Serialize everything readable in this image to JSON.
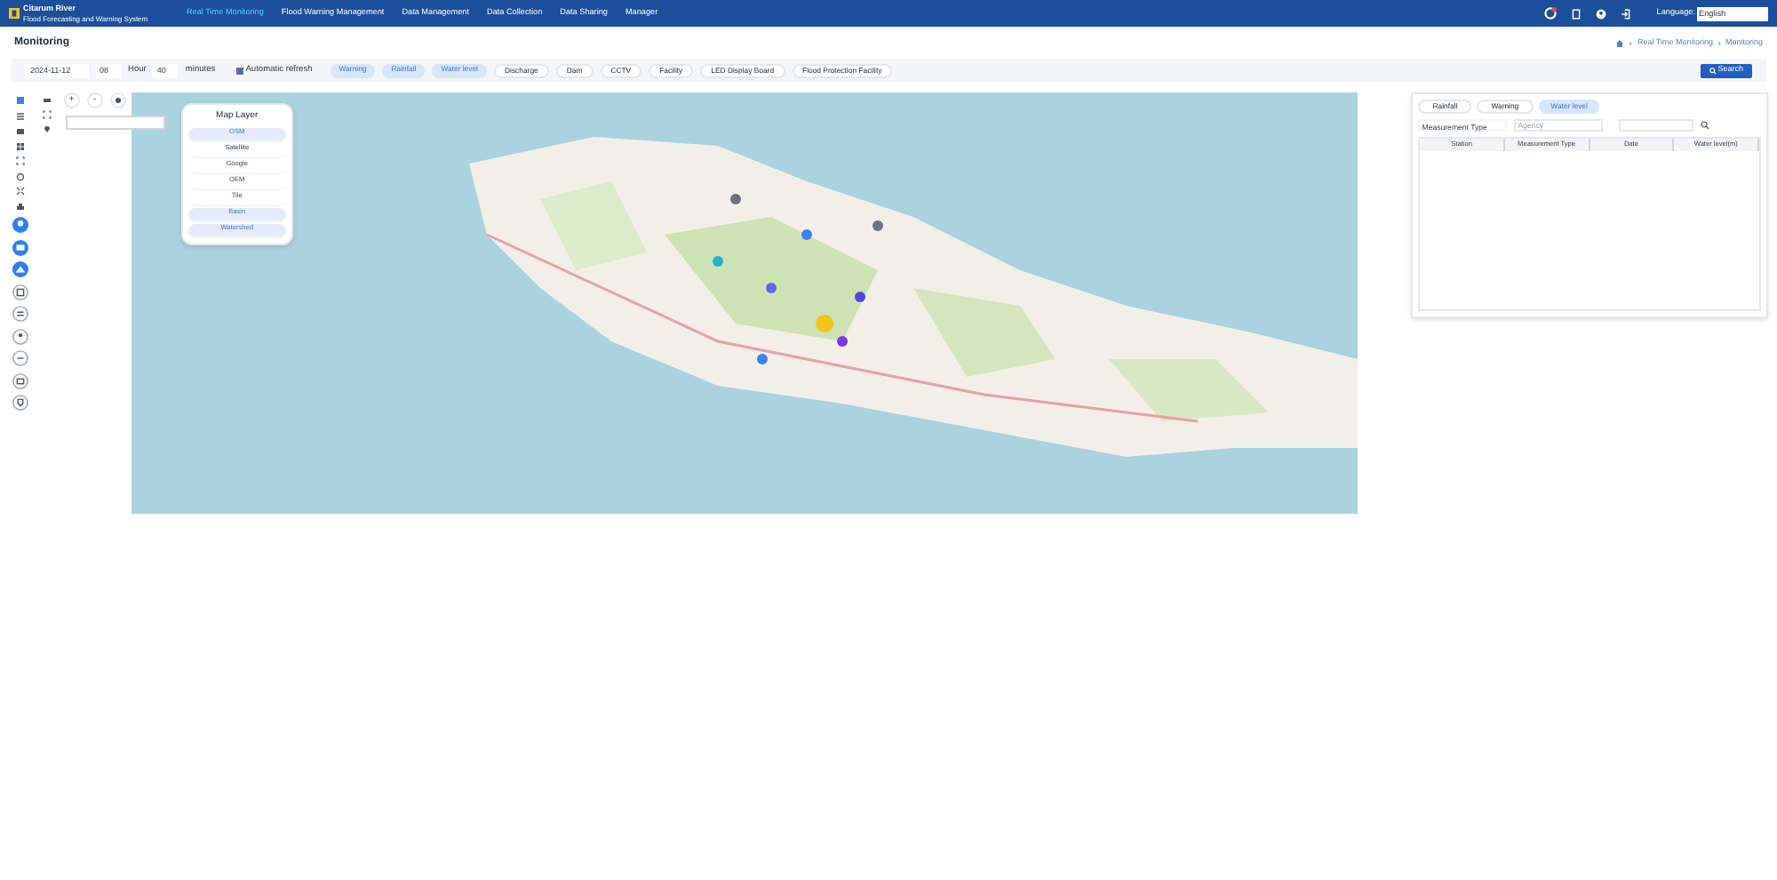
{
  "header": {
    "logo_title": "Citarum River",
    "logo_subtitle": "Flood Forecasting and Warning System",
    "nav": [
      {
        "label": "Real Time Monitoring",
        "selected": true
      },
      {
        "label": "Flood Warning Management",
        "selected": false
      },
      {
        "label": "Data Management",
        "selected": false
      },
      {
        "label": "Data Collection",
        "selected": false
      },
      {
        "label": "Data Sharing",
        "selected": false
      },
      {
        "label": "Manager",
        "selected": false
      }
    ],
    "language_label": "Language:",
    "language_value": "English"
  },
  "page_title": "Monitoring",
  "breadcrumb": [
    "Real Time Monitoring",
    "Monitoring"
  ],
  "filters": {
    "date": "2024-11-12",
    "hour": "08",
    "hour_label": "Hour",
    "minute": "40",
    "minute_label": "minutes",
    "auto_refresh": {
      "label": "Automatic refresh",
      "checked": true
    },
    "chips": [
      {
        "label": "Warning",
        "selected": true
      },
      {
        "label": "Rainfall",
        "selected": true
      },
      {
        "label": "Water level",
        "selected": true
      },
      {
        "label": "Discharge",
        "selected": false
      },
      {
        "label": "Dam",
        "selected": false
      },
      {
        "label": "CCTV",
        "selected": false
      },
      {
        "label": "Facility",
        "selected": false
      },
      {
        "label": "LED Display Board",
        "selected": false
      },
      {
        "label": "Flood Protection Facility",
        "selected": false
      }
    ],
    "search_button": "Search"
  },
  "map_layer": {
    "title": "Map Layer",
    "items": [
      {
        "label": "OSM",
        "selected": true
      },
      {
        "label": "Satellite",
        "selected": false
      },
      {
        "label": "Google",
        "selected": false
      },
      {
        "label": "OEM",
        "selected": false
      },
      {
        "label": "Tile",
        "selected": false
      },
      {
        "label": "Basin",
        "selected": true
      },
      {
        "label": "Watershed",
        "selected": true
      }
    ]
  },
  "map_controls": [
    "+",
    "-"
  ],
  "panel": {
    "tabs": [
      {
        "label": "Rainfall",
        "selected": false
      },
      {
        "label": "Warning",
        "selected": false
      },
      {
        "label": "Water level",
        "selected": true
      }
    ],
    "measurement_label": "Measurement Type",
    "agency_placeholder": "Agency",
    "columns": [
      "Station",
      "Measurement Type",
      "Date",
      "Water level(m)"
    ]
  }
}
